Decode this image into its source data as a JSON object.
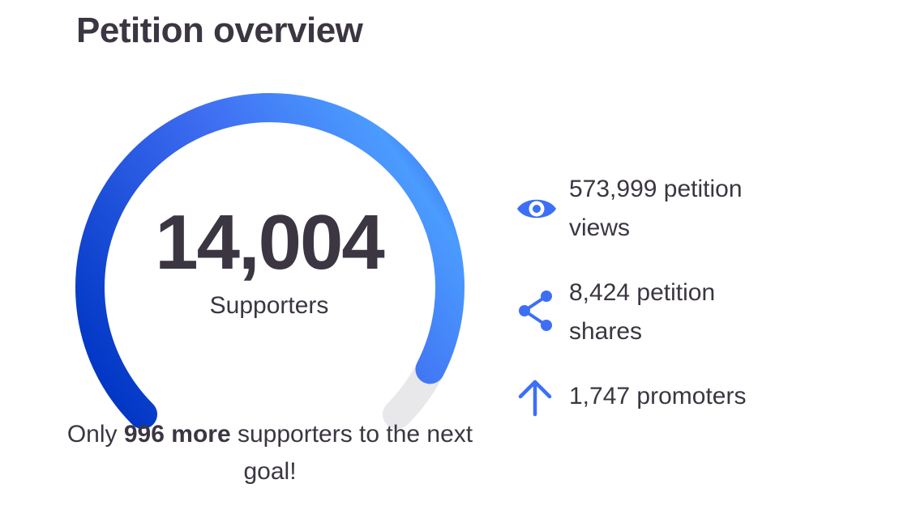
{
  "header": {
    "title": "Petition overview"
  },
  "gauge": {
    "supporters_count": "14,004",
    "supporters_label": "Supporters",
    "progress_fraction": 0.934,
    "colors": {
      "arc_start": "#0036c4",
      "arc_mid": "#3f6ef2",
      "arc_peak": "#4b9cff",
      "arc_end": "#2d5ae9",
      "track": "#e8e8ea"
    }
  },
  "goal": {
    "prefix": "Only ",
    "highlight": "996 more",
    "suffix": " supporters to the next goal!"
  },
  "stats": [
    {
      "icon": "eye-icon",
      "text": "573,999 petition views"
    },
    {
      "icon": "share-icon",
      "text": "8,424 petition shares"
    },
    {
      "icon": "arrow-up-icon",
      "text": "1,747 promoters"
    }
  ],
  "colors": {
    "text": "#3b3641",
    "icon": "#3d6ff5"
  }
}
